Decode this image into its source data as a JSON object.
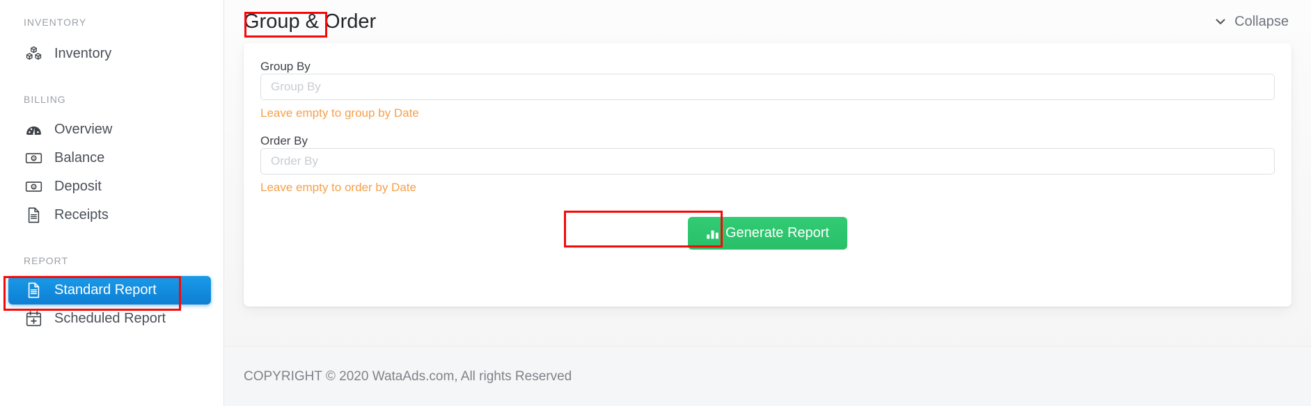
{
  "sidebar": {
    "sections": [
      {
        "label": "INVENTORY",
        "items": [
          {
            "label": "Inventory",
            "icon": "boxes-icon",
            "active": false
          }
        ]
      },
      {
        "label": "BILLING",
        "items": [
          {
            "label": "Overview",
            "icon": "tachometer-icon",
            "active": false
          },
          {
            "label": "Balance",
            "icon": "money-bill-icon",
            "active": false
          },
          {
            "label": "Deposit",
            "icon": "money-bill-icon",
            "active": false
          },
          {
            "label": "Receipts",
            "icon": "file-lines-icon",
            "active": false
          }
        ]
      },
      {
        "label": "REPORT",
        "items": [
          {
            "label": "Standard Report",
            "icon": "file-lines-icon",
            "active": true
          },
          {
            "label": "Scheduled Report",
            "icon": "calendar-plus-icon",
            "active": false
          }
        ]
      }
    ]
  },
  "header": {
    "title": "Group & Order",
    "collapse_label": "Collapse",
    "collapse_icon": "chevron-down-icon"
  },
  "form": {
    "group_by": {
      "label": "Group By",
      "placeholder": "Group By",
      "value": "",
      "hint": "Leave empty to group by Date"
    },
    "order_by": {
      "label": "Order By",
      "placeholder": "Order By",
      "value": "",
      "hint": "Leave empty to order by Date"
    },
    "generate_button": {
      "label": "Generate Report",
      "icon": "bar-chart-icon"
    }
  },
  "footer": {
    "copyright": "COPYRIGHT © 2020 WataAds.com, All rights Reserved"
  },
  "colors": {
    "accent_blue": "#0d7fd4",
    "success_green": "#2ecc71",
    "hint_orange": "#f5a04a",
    "annotation_red": "#f70808"
  }
}
